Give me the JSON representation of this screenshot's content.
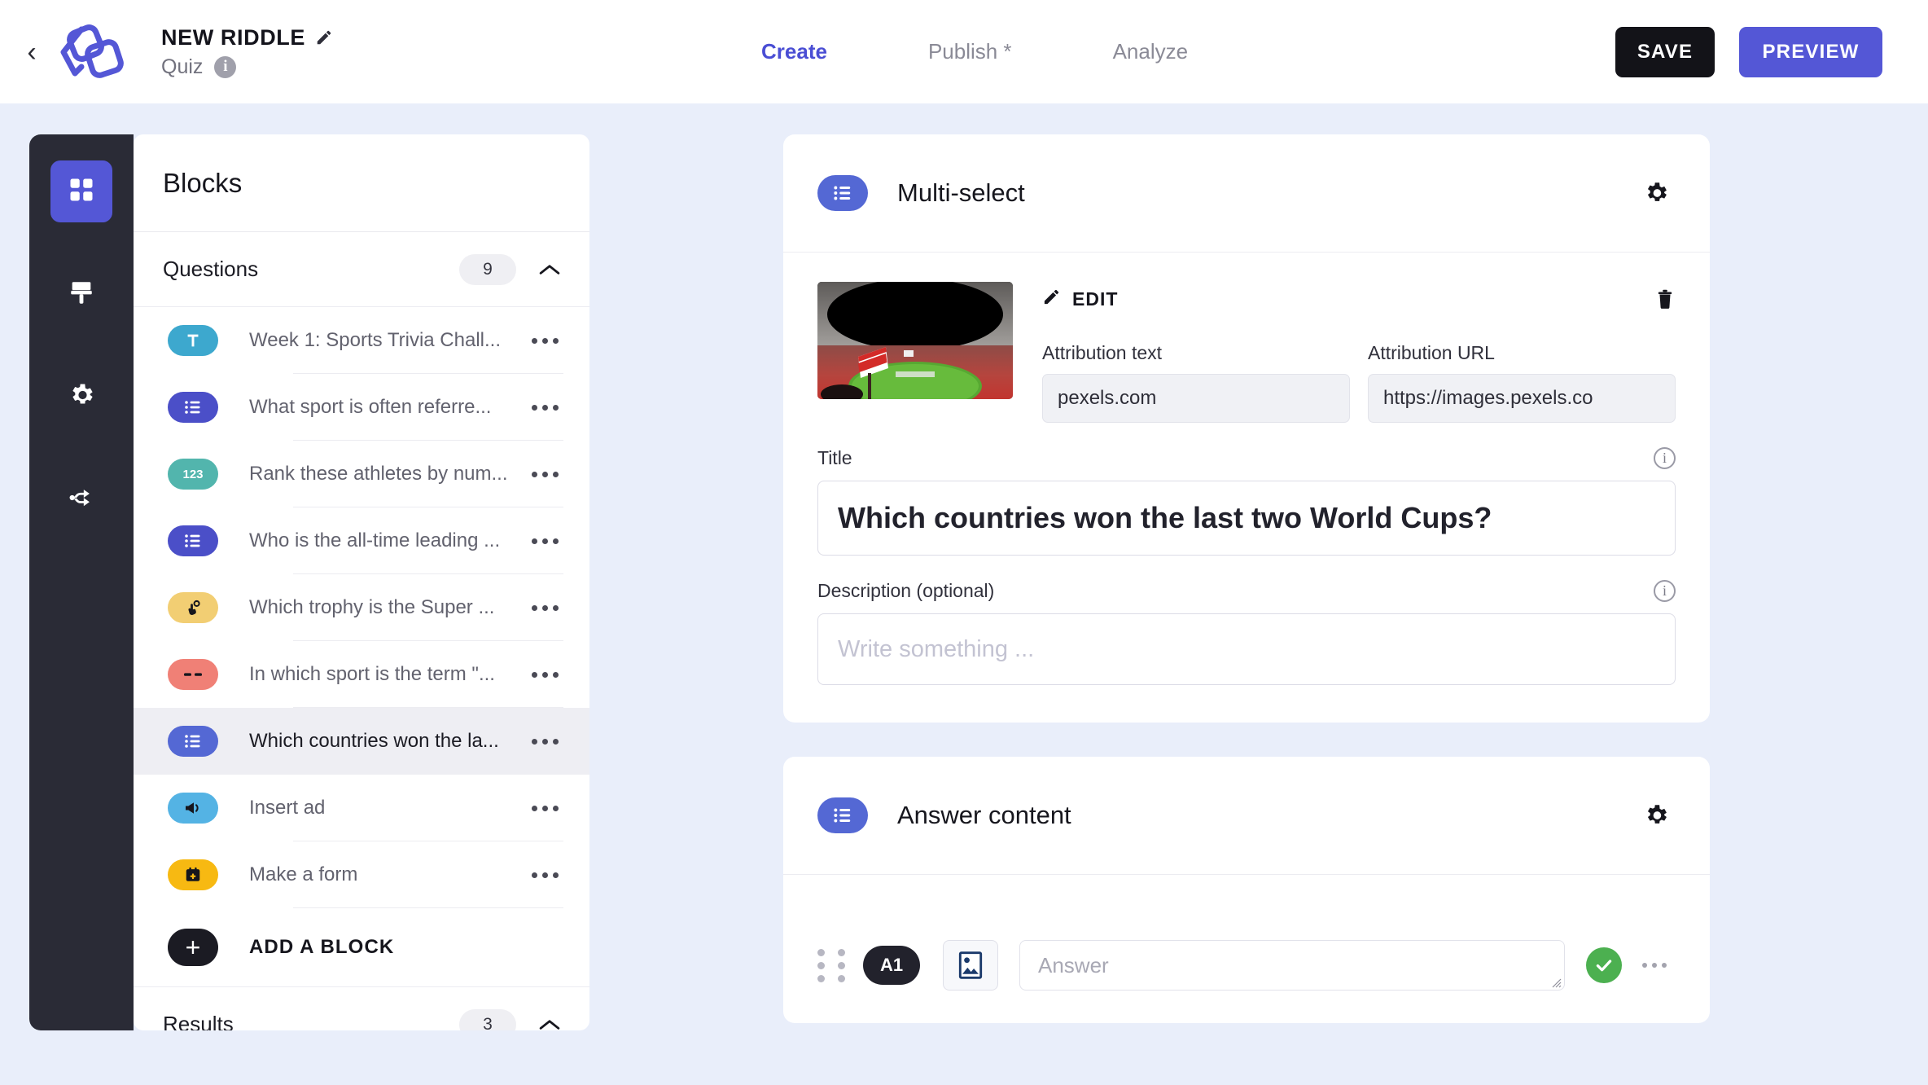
{
  "header": {
    "back_icon": "chevron-left-icon",
    "logo_icon": "riddle-logo",
    "project_title": "NEW RIDDLE",
    "edit_icon": "pencil-icon",
    "project_type": "Quiz",
    "info_icon": "info-icon",
    "tabs": [
      {
        "label": "Create",
        "active": true
      },
      {
        "label": "Publish *",
        "active": false
      },
      {
        "label": "Analyze",
        "active": false
      }
    ],
    "save_label": "SAVE",
    "preview_label": "PREVIEW",
    "save_color": "#131318",
    "preview_color": "#5457d6",
    "accent_color": "#4a4ed4"
  },
  "rail": {
    "items": [
      {
        "icon": "grid-blocks-icon",
        "active": true
      },
      {
        "icon": "paintbrush-icon",
        "active": false
      },
      {
        "icon": "gear-icon",
        "active": false
      },
      {
        "icon": "share-branch-icon",
        "active": false
      }
    ],
    "background": "#2a2b36",
    "active_color": "#5457d6"
  },
  "blocks_panel": {
    "title": "Blocks",
    "questions_section": {
      "name": "Questions",
      "count": "9",
      "collapse_icon": "chevron-up-icon"
    },
    "items": [
      {
        "label": "Week 1: Sports Trivia Chall...",
        "icon": "text-block-icon",
        "glyph": "T",
        "color": "#3da8ce",
        "selected": false
      },
      {
        "label": "What sport is often referre...",
        "icon": "multi-select-icon",
        "glyph": "list",
        "color": "#4b4fc8",
        "selected": false
      },
      {
        "label": "Rank these athletes by num...",
        "icon": "ranking-icon",
        "glyph": "123",
        "color": "#52b5ad",
        "selected": false
      },
      {
        "label": "Who is the all-time leading ...",
        "icon": "multi-select-icon",
        "glyph": "list",
        "color": "#4b4fc8",
        "selected": false
      },
      {
        "label": "Which trophy is the Super ...",
        "icon": "tap-choice-icon",
        "glyph": "tap",
        "color": "#f2ce73",
        "selected": false
      },
      {
        "label": "In which sport is the term \"...",
        "icon": "blank-fill-icon",
        "glyph": "dashes",
        "color": "#f08076",
        "selected": false
      },
      {
        "label": "Which countries won the la...",
        "icon": "multi-select-icon",
        "glyph": "list",
        "color": "#5468d4",
        "selected": true
      },
      {
        "label": "Insert ad",
        "icon": "megaphone-icon",
        "glyph": "ad",
        "color": "#54b3e4",
        "selected": false
      },
      {
        "label": "Make a form",
        "icon": "form-icon",
        "glyph": "form",
        "color": "#f7b912",
        "selected": false
      }
    ],
    "row_menu_icon": "more-options-icon",
    "add_block": {
      "label": "ADD A BLOCK",
      "icon": "plus-icon"
    },
    "results_section": {
      "name": "Results",
      "count": "3",
      "collapse_icon": "chevron-up-icon"
    },
    "selected_row_bg": "#eeeef3"
  },
  "question_card": {
    "type_icon": "multi-select-icon",
    "type_label": "Multi-select",
    "settings_icon": "gear-icon",
    "media": {
      "thumb_alt": "stadium-photo",
      "edit_label": "EDIT",
      "edit_icon": "pencil-icon",
      "delete_icon": "trash-icon"
    },
    "attribution_text": {
      "label": "Attribution text",
      "value": "pexels.com"
    },
    "attribution_url": {
      "label": "Attribution URL",
      "value": "https://images.pexels.co"
    },
    "title_field": {
      "label": "Title",
      "value": "Which countries won the last two World Cups?",
      "info_icon": "info-icon"
    },
    "description_field": {
      "label": "Description (optional)",
      "placeholder": "Write something ...",
      "value": "",
      "info_icon": "info-icon"
    }
  },
  "answer_card": {
    "type_icon": "multi-select-icon",
    "type_label": "Answer content",
    "settings_icon": "gear-icon",
    "rows": [
      {
        "drag_icon": "drag-handle-icon",
        "badge": "A1",
        "image_icon": "image-icon",
        "placeholder": "Answer",
        "value": "",
        "correct_icon": "check-circle-icon",
        "correct_color": "#4cb050",
        "menu_icon": "more-options-icon"
      }
    ]
  },
  "page_background": "#e9eefa"
}
